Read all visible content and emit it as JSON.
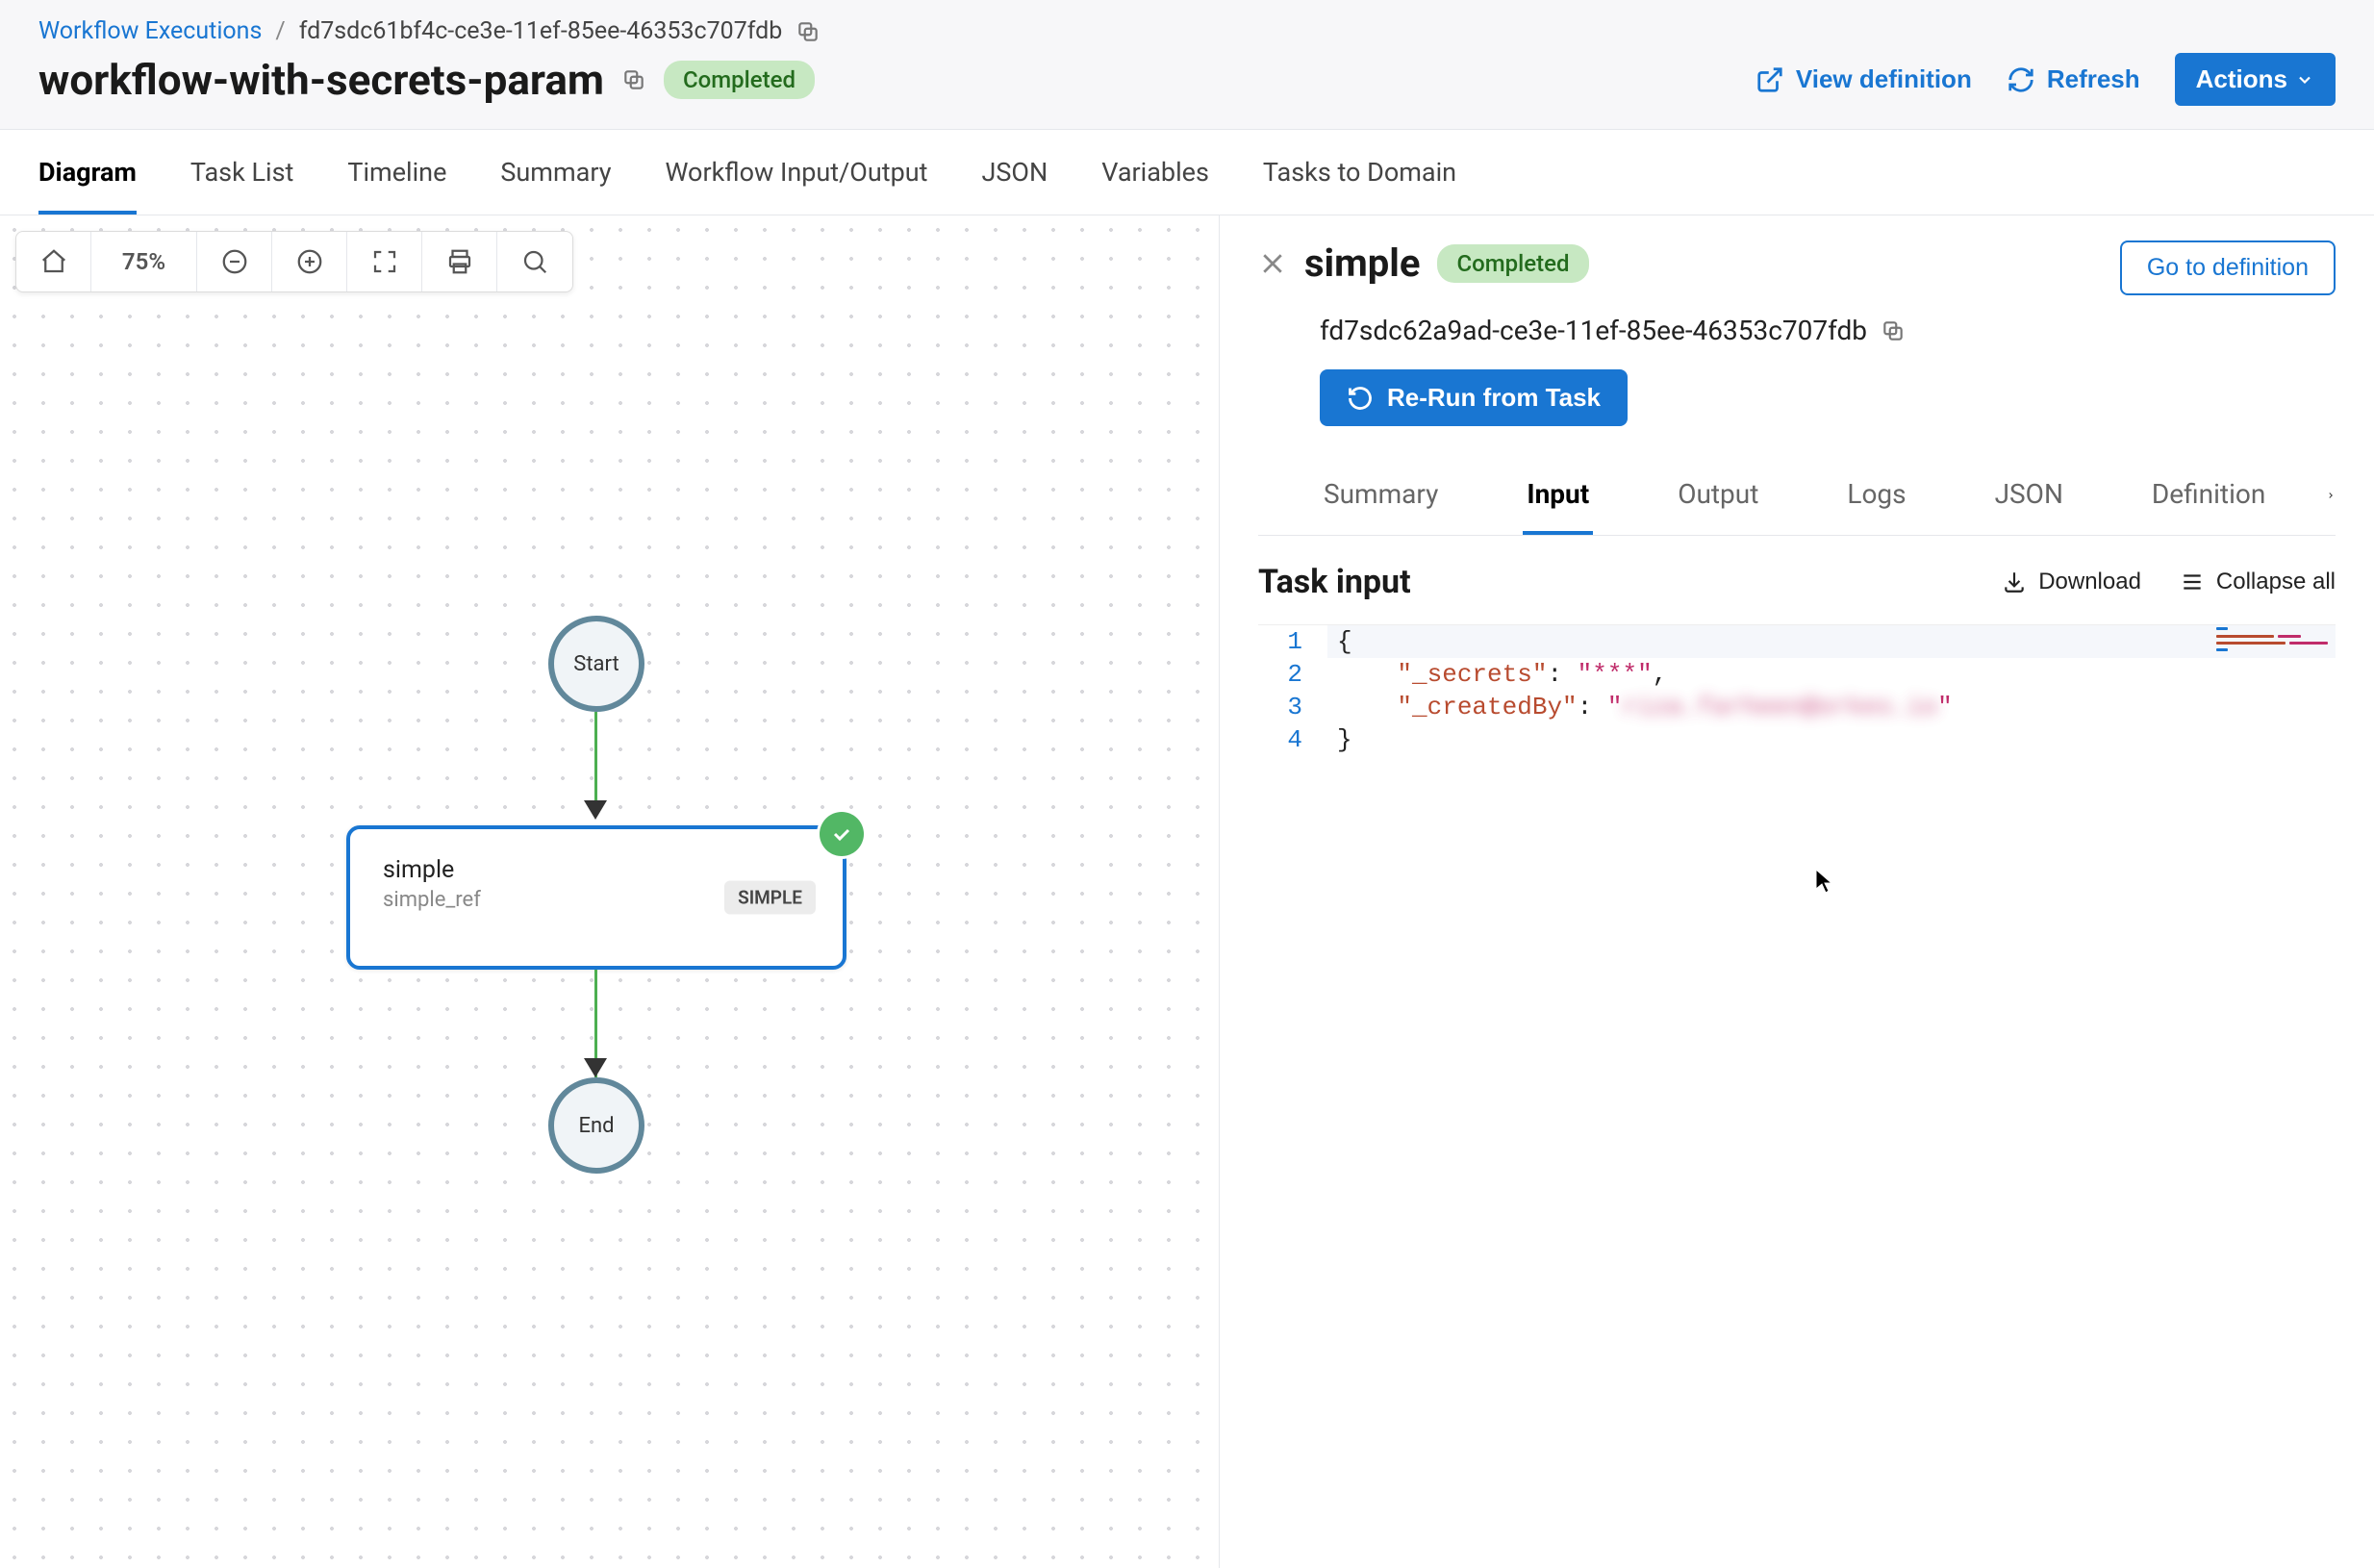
{
  "breadcrumb": {
    "root": "Workflow Executions",
    "id": "fd7sdc61bf4c-ce3e-11ef-85ee-46353c707fdb"
  },
  "page": {
    "title": "workflow-with-secrets-param",
    "status": "Completed"
  },
  "header_actions": {
    "view_def": "View definition",
    "refresh": "Refresh",
    "actions": "Actions"
  },
  "main_tabs": [
    "Diagram",
    "Task List",
    "Timeline",
    "Summary",
    "Workflow Input/Output",
    "JSON",
    "Variables",
    "Tasks to Domain"
  ],
  "main_tabs_active": 0,
  "canvas": {
    "zoom": "75%",
    "start_label": "Start",
    "end_label": "End",
    "task_name": "simple",
    "task_ref": "simple_ref",
    "task_type": "SIMPLE"
  },
  "panel": {
    "title": "simple",
    "status": "Completed",
    "go_def": "Go to definition",
    "task_id": "fd7sdc62a9ad-ce3e-11ef-85ee-46353c707fdb",
    "rerun": "Re-Run from Task",
    "tabs": [
      "Summary",
      "Input",
      "Output",
      "Logs",
      "JSON",
      "Definition"
    ],
    "tabs_active": 1,
    "section_title": "Task input",
    "download": "Download",
    "collapse": "Collapse all",
    "code_strings": {
      "secrets_key": "\"_secrets\"",
      "secrets_val": "\"***\"",
      "created_key": "\"_createdBy\"",
      "created_blur": "riza.farheen@orkes.io",
      "open": "{",
      "close": "}"
    }
  }
}
